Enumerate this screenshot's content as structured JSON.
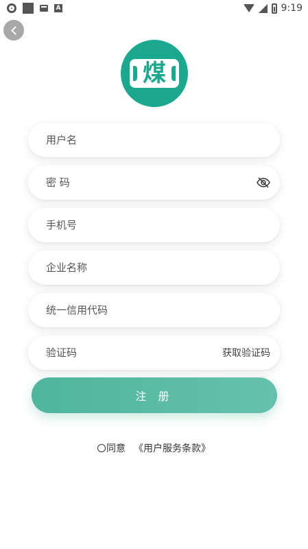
{
  "status_bar": {
    "time": "9:19",
    "icons": [
      "settings-icon",
      "square-icon",
      "mail-icon",
      "a-icon",
      "wifi-icon",
      "signal-icon",
      "battery-icon"
    ]
  },
  "back_icon": "chevron-left-icon",
  "logo": {
    "char": "煤"
  },
  "form": {
    "username_placeholder": "用户名",
    "password_placeholder": "密 码",
    "phone_placeholder": "手机号",
    "company_placeholder": "企业名称",
    "credit_code_placeholder": "统一信用代码",
    "verification_placeholder": "验证码",
    "get_code_label": "获取验证码"
  },
  "register_label": "注 册",
  "agreement": {
    "agree_label": "同意",
    "terms_label": "《用户服务条款》"
  },
  "colors": {
    "brand": "#1aa88e",
    "button": "#57b9a3"
  }
}
